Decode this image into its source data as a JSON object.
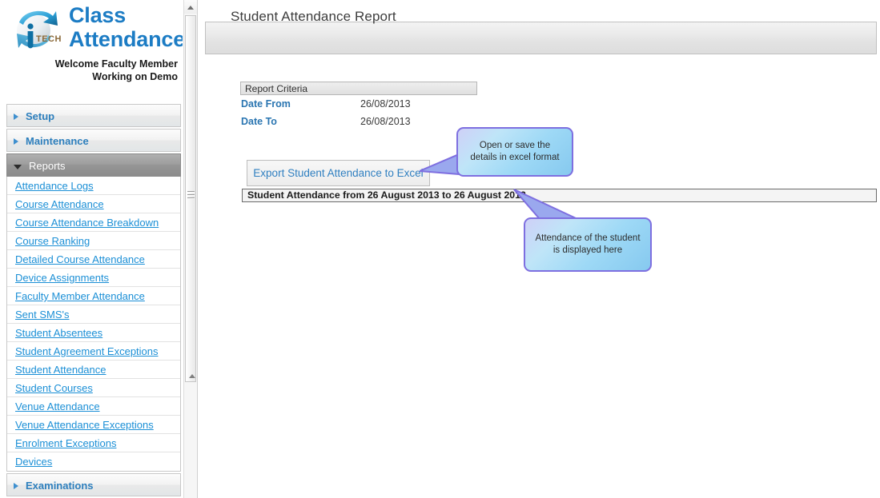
{
  "brand": {
    "line1": "Class",
    "line2": "Attendance",
    "logo_icon": "itech-globe-logo",
    "welcome_line1": "Welcome Faculty Member",
    "welcome_line2": "Working on Demo",
    "accent_color": "#1c7cc4"
  },
  "sidebar": {
    "sections": [
      {
        "label": "Setup",
        "state": "collapsed",
        "icon": "chevron-right-icon"
      },
      {
        "label": "Maintenance",
        "state": "collapsed",
        "icon": "chevron-right-icon"
      },
      {
        "label": "Reports",
        "state": "expanded",
        "icon": "chevron-down-icon"
      },
      {
        "label": "Examinations",
        "state": "collapsed",
        "icon": "chevron-right-icon"
      }
    ],
    "reports_links": [
      "Attendance Logs",
      "Course Attendance",
      "Course Attendance Breakdown",
      "Course Ranking",
      "Detailed Course Attendance",
      "Device Assignments",
      "Faculty Member Attendance",
      "Sent SMS's",
      "Student Absentees",
      "Student Agreement Exceptions",
      "Student Attendance",
      "Student Courses",
      "Venue Attendance",
      "Venue Attendance Exceptions",
      "Enrolment Exceptions",
      "Devices"
    ],
    "link_color": "#1b8fd6"
  },
  "scrollbar": {
    "up_arrow_icon": "triangle-up-icon",
    "down_arrow_icon": "triangle-down-icon",
    "grip_icon": "grip-lines-icon"
  },
  "main": {
    "page_title": "Student Attendance Report",
    "criteria": {
      "header": "Report Criteria",
      "rows": [
        {
          "label": "Date From",
          "value": "26/08/2013"
        },
        {
          "label": "Date To",
          "value": "26/08/2013"
        }
      ]
    },
    "export_button_label": "Export Student Attendance to Excel",
    "result_bar_text": "Student Attendance from 26 August 2013 to 26 August 2013"
  },
  "callouts": [
    {
      "id": "excel",
      "line1": "Open or save the",
      "line2": "details in excel format",
      "border_color": "#7e6fe0",
      "fill_color": "#9ed9f6"
    },
    {
      "id": "grid",
      "line1": "Attendance of the student",
      "line2": "is displayed here",
      "border_color": "#7e6fe0",
      "fill_color": "#9ed9f6"
    }
  ]
}
